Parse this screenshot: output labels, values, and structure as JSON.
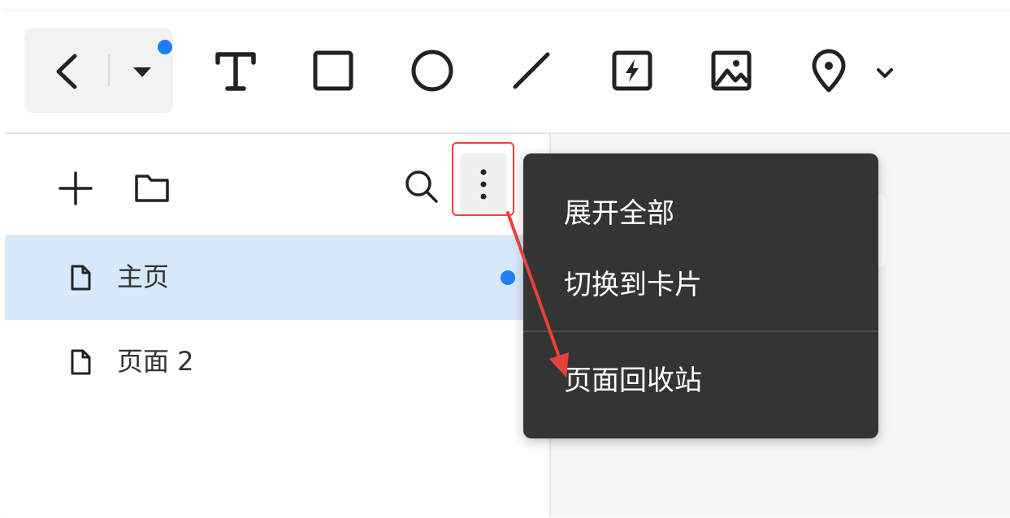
{
  "toolbar": {
    "back_icon": "chevron-left-icon",
    "dropdown_icon": "caret-down-icon",
    "tools": [
      {
        "name": "text-tool",
        "icon": "text-icon"
      },
      {
        "name": "rectangle-tool",
        "icon": "rectangle-icon"
      },
      {
        "name": "ellipse-tool",
        "icon": "ellipse-icon"
      },
      {
        "name": "line-tool",
        "icon": "line-icon"
      },
      {
        "name": "interaction-tool",
        "icon": "lightning-icon"
      },
      {
        "name": "image-tool",
        "icon": "image-icon"
      },
      {
        "name": "location-tool",
        "icon": "map-pin-icon"
      }
    ],
    "more_icon": "chevron-down-icon"
  },
  "panel": {
    "actions": [
      "add-icon",
      "folder-icon",
      "search-icon",
      "more-vertical-icon"
    ],
    "pages": [
      {
        "label": "主页",
        "active": true,
        "has_indicator": true
      },
      {
        "label": "页面 2",
        "active": false,
        "has_indicator": false
      }
    ]
  },
  "menu": {
    "items": [
      {
        "label": "展开全部"
      },
      {
        "label": "切换到卡片"
      },
      {
        "label": "页面回收站"
      }
    ]
  },
  "colors": {
    "accent": "#1e7ef5",
    "active_row": "#d8e8fb",
    "menu_bg": "#343434",
    "annotation": "#e8413b"
  }
}
